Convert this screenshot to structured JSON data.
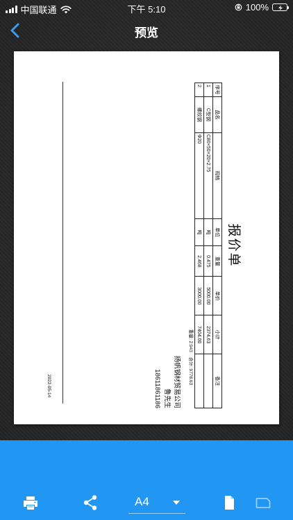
{
  "status_bar": {
    "carrier": "中国联通",
    "time": "下午 5:10",
    "battery": "100%"
  },
  "nav": {
    "title": "预览"
  },
  "document": {
    "title": "报价单",
    "headers": [
      "序号",
      "品名",
      "规格",
      "单位",
      "重量",
      "单价",
      "小计",
      "备注"
    ],
    "rows": [
      [
        "1",
        "C型钢",
        "C80×50×20×2.75",
        "吨",
        "0.475",
        "5000.00",
        "2374.63",
        ""
      ],
      [
        "2",
        "螺纹钢",
        "Φ20",
        "吨",
        "2.468",
        "3000.00",
        "7404.00",
        ""
      ]
    ],
    "weight_label": "重量:",
    "weight_value": "2.943",
    "total_label": "合计:",
    "total_value": "9778.63",
    "company": "扬帆钢材贸易公司",
    "contact": "鲁先生",
    "phone": "18611861186",
    "date": "2022-05-14"
  },
  "toolbar": {
    "paper_size": "A4",
    "icons": [
      "printer-icon",
      "share-icon",
      "dropdown-caret-icon",
      "portrait-page-icon",
      "landscape-page-icon"
    ]
  },
  "colors": {
    "accent": "#2196f3",
    "background": "#2a2a2a",
    "battery_fill": "#4cd964"
  }
}
